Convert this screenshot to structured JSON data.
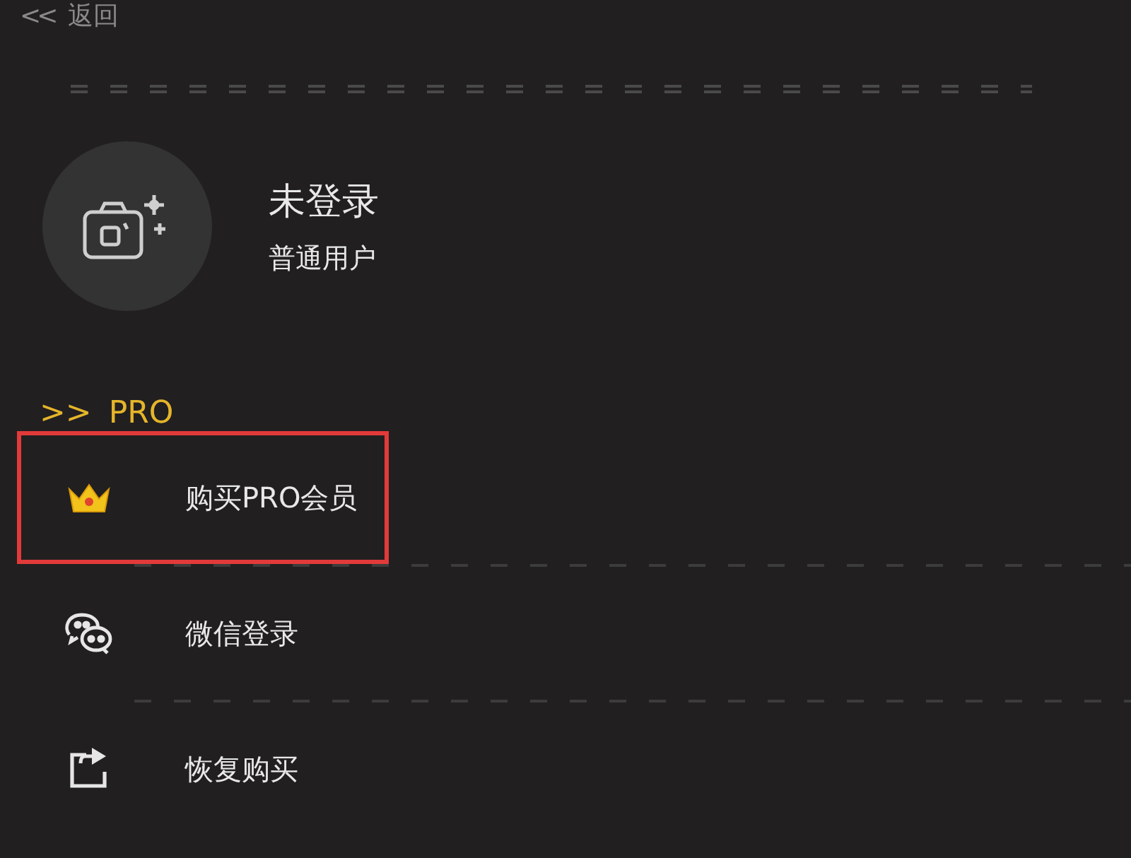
{
  "back": {
    "icon": "<<",
    "label": "返回"
  },
  "profile": {
    "name": "未登录",
    "level": "普通用户"
  },
  "section": {
    "icon": ">>",
    "title": "PRO"
  },
  "menu": [
    {
      "kind": "crown",
      "label": "购买PRO会员",
      "highlighted": true
    },
    {
      "kind": "wechat",
      "label": "微信登录",
      "highlighted": false
    },
    {
      "kind": "share",
      "label": "恢复购买",
      "highlighted": false
    }
  ]
}
